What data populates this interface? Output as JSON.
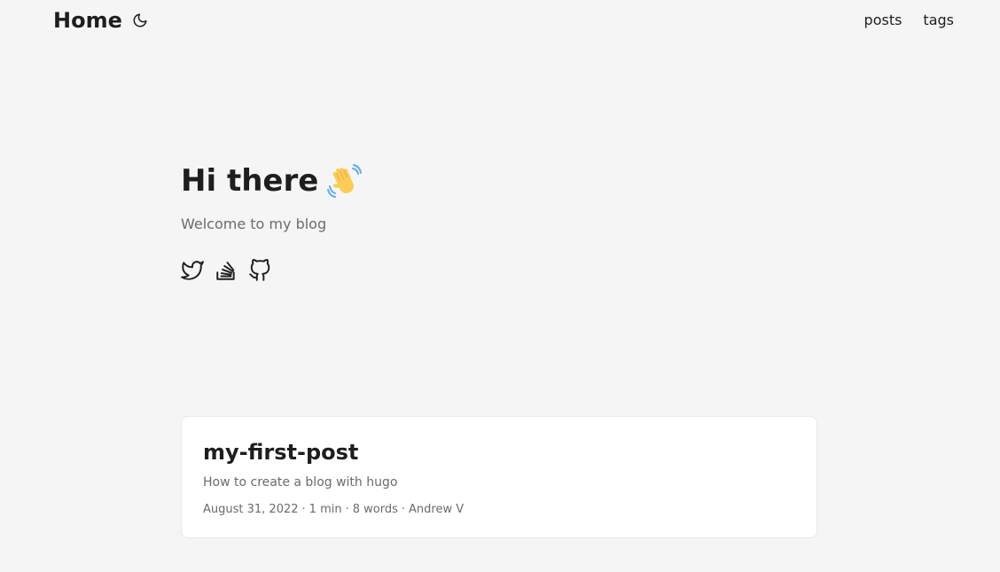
{
  "header": {
    "logo": "Home",
    "theme_toggle_icon": "moon-icon",
    "menu": [
      {
        "label": "posts"
      },
      {
        "label": "tags"
      }
    ]
  },
  "hero": {
    "title": "Hi there",
    "emoji_icon": "waving-hand-icon",
    "subtitle": "Welcome to my blog",
    "socials": [
      {
        "icon": "twitter-icon"
      },
      {
        "icon": "stackoverflow-icon"
      },
      {
        "icon": "github-icon"
      }
    ]
  },
  "posts": [
    {
      "title": "my-first-post",
      "summary": "How to create a blog with hugo",
      "date": "August 31, 2022",
      "reading_time": "1 min",
      "words": "8 words",
      "author": "Andrew V",
      "separator": "·"
    }
  ],
  "colors": {
    "background": "#f5f5f5",
    "card": "#ffffff",
    "text": "#1e1e1e",
    "secondary_text": "#6b6b6b"
  }
}
